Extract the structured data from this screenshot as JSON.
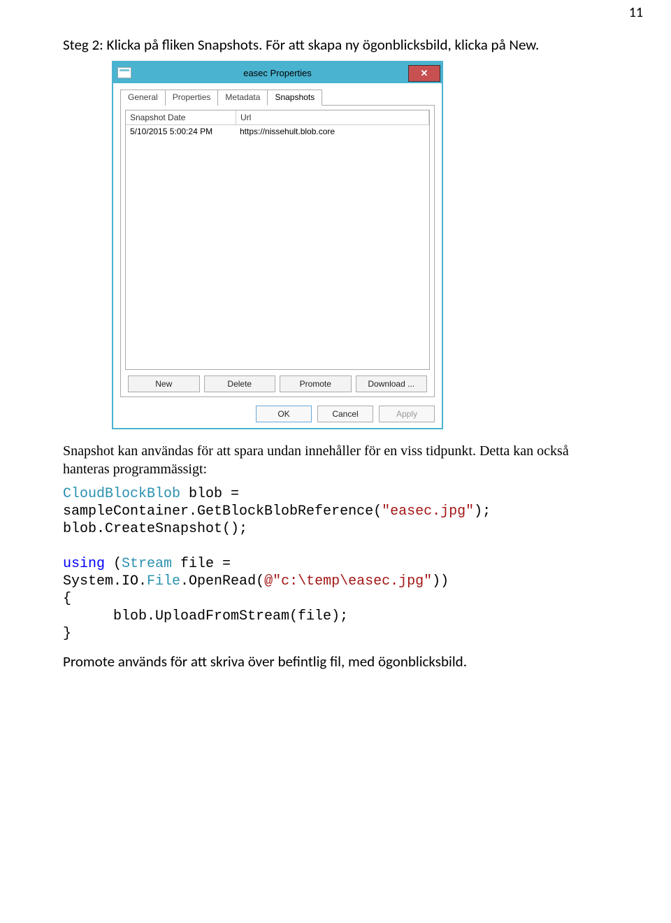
{
  "page_number": "11",
  "step_text": "Steg 2: Klicka på fliken Snapshots. För att skapa ny ögonblicksbild, klicka på New.",
  "dialog": {
    "title": "easec Properties",
    "tabs": {
      "general": "General",
      "properties": "Properties",
      "metadata": "Metadata",
      "snapshots": "Snapshots"
    },
    "listview": {
      "col1": "Snapshot Date",
      "col2": "Url",
      "row1_date": "5/10/2015 5:00:24 PM",
      "row1_url": "https://nissehult.blob.core"
    },
    "buttons": {
      "new": "New",
      "delete": "Delete",
      "promote": "Promote",
      "download": "Download ..."
    },
    "footer": {
      "ok": "OK",
      "cancel": "Cancel",
      "apply": "Apply"
    }
  },
  "para1": "Snapshot kan användas för att spara undan innehåller för en viss tidpunkt. Detta kan också hanteras programmässigt:",
  "code": {
    "t_cloudblockblob": "CloudBlockBlob",
    "v_blob": " blob = ",
    "l2": "sampleContainer.GetBlockBlobReference(",
    "s_easec": "\"easec.jpg\"",
    "l2_end": ");",
    "l3": "blob.CreateSnapshot();",
    "kw_using": "using",
    "p_open": " (",
    "t_stream": "Stream",
    "v_file": " file = ",
    "l5": "System.IO.",
    "t_file": "File",
    "l5b": ".OpenRead(",
    "s_path": "@\"c:\\temp\\easec.jpg\"",
    "l5_end": "))",
    "brace_open": "{",
    "l7": "      blob.UploadFromStream(file);",
    "brace_close": "}"
  },
  "bottom": "Promote används för att skriva över befintlig fil, med ögonblicksbild."
}
